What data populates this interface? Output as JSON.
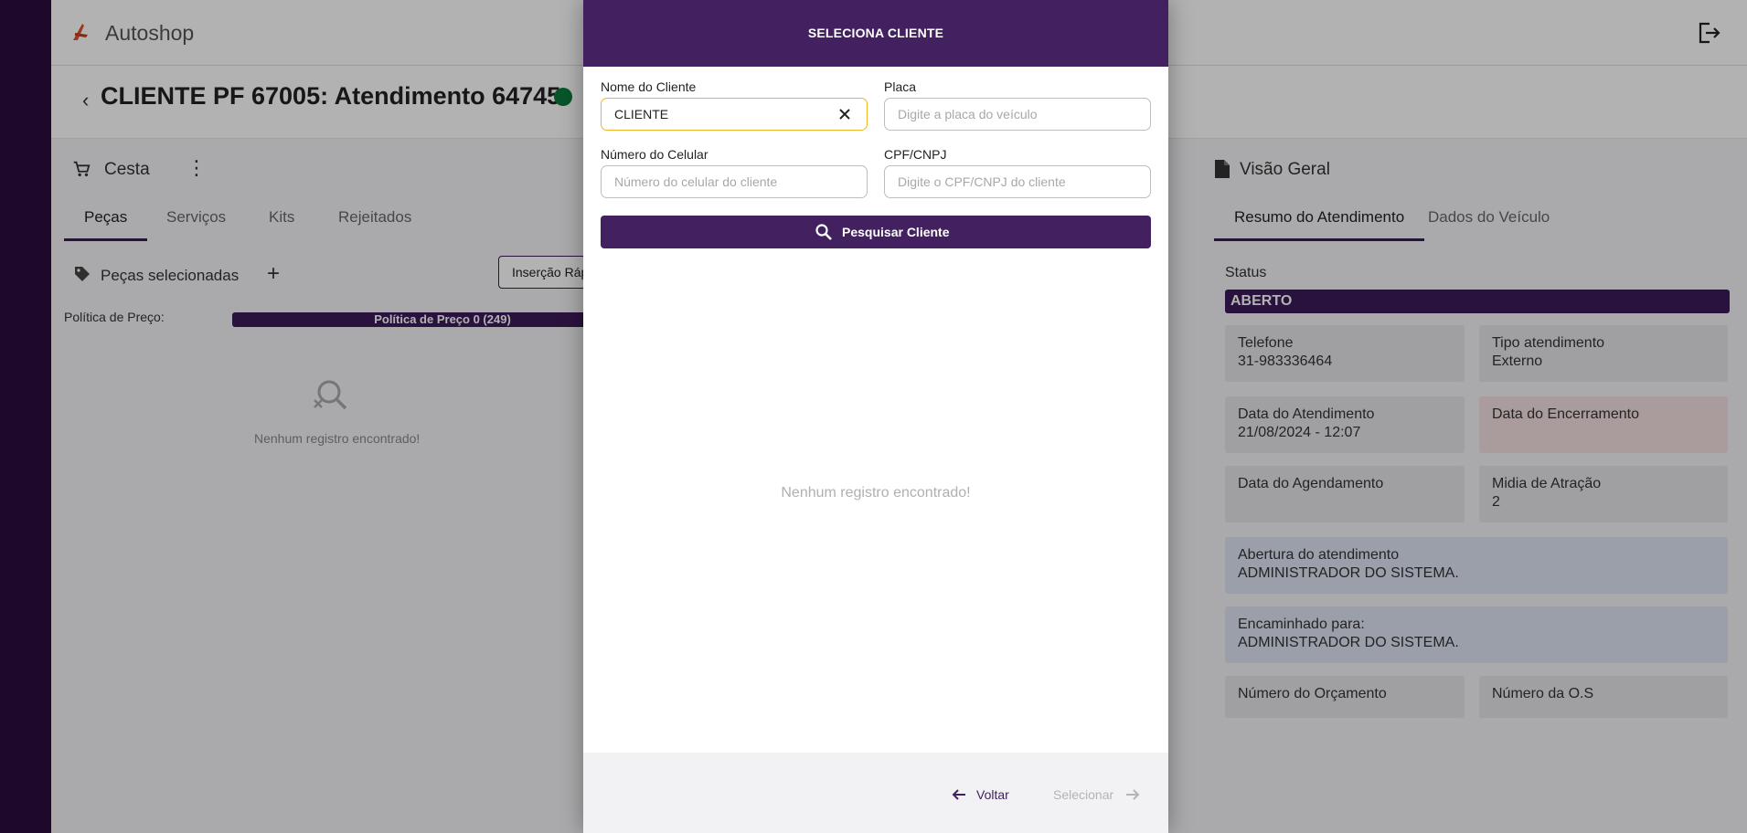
{
  "app": {
    "brand": "Autoshop",
    "page_title": "CLIENTE PF 67005: Atendimento 64745"
  },
  "left_panel": {
    "section_title": "Cesta",
    "tabs": [
      {
        "label": "Peças",
        "active": true
      },
      {
        "label": "Serviços",
        "active": false
      },
      {
        "label": "Kits",
        "active": false
      },
      {
        "label": "Rejeitados",
        "active": false
      }
    ],
    "selected_title": "Peças selecionadas",
    "quick_insert": "Inserção Rápida",
    "price_policy_label": "Política de Preço:",
    "price_policy_value": "Política de Preço 0 (249)",
    "empty_text": "Nenhum registro encontrado!"
  },
  "right_panel": {
    "section_title": "Visão Geral",
    "tabs": [
      {
        "label": "Resumo do Atendimento",
        "active": true
      },
      {
        "label": "Dados do Veículo",
        "active": false
      }
    ],
    "status_label": "Status",
    "status_value": "ABERTO",
    "cards": {
      "telefone": {
        "label": "Telefone",
        "value": "31-983336464"
      },
      "tipo": {
        "label": "Tipo atendimento",
        "value": "Externo"
      },
      "data_atendimento": {
        "label": "Data do Atendimento",
        "value": "21/08/2024 - 12:07"
      },
      "data_encerramento": {
        "label": "Data do Encerramento",
        "value": ""
      },
      "data_agendamento": {
        "label": "Data do Agendamento",
        "value": ""
      },
      "midia": {
        "label": "Midia de Atração",
        "value": "2"
      },
      "abertura": {
        "label": "Abertura do atendimento",
        "value": "ADMINISTRADOR DO SISTEMA."
      },
      "encaminhado": {
        "label": "Encaminhado para:",
        "value": "ADMINISTRADOR DO SISTEMA."
      },
      "orcamento": {
        "label": "Número do Orçamento",
        "value": ""
      },
      "os": {
        "label": "Número da O.S",
        "value": ""
      }
    }
  },
  "modal": {
    "title": "SELECIONA CLIENTE",
    "fields": {
      "nome": {
        "label": "Nome do Cliente",
        "value": "CLIENTE",
        "placeholder": ""
      },
      "placa": {
        "label": "Placa",
        "value": "",
        "placeholder": "Digite a placa do veículo"
      },
      "celular": {
        "label": "Número do Celular",
        "value": "",
        "placeholder": "Número do celular do cliente"
      },
      "cpf": {
        "label": "CPF/CNPJ",
        "value": "",
        "placeholder": "Digite o CPF/CNPJ do cliente"
      }
    },
    "search_button": "Pesquisar Cliente",
    "empty_text": "Nenhum registro encontrado!",
    "back_button": "Voltar",
    "select_button": "Selecionar"
  },
  "colors": {
    "primary": "#43205f",
    "rail": "#2b0d3e",
    "focus": "#f0b429",
    "status_dot": "#0b7a3b"
  }
}
